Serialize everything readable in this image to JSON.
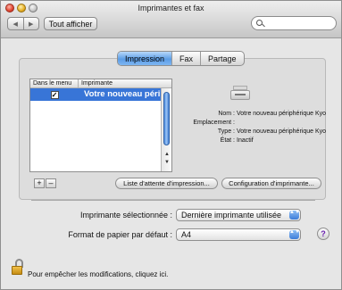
{
  "window": {
    "title": "Imprimantes et fax"
  },
  "toolbar": {
    "back": "◀",
    "forward": "▶",
    "show_all": "Tout afficher",
    "search_placeholder": ""
  },
  "tabs": [
    {
      "label": "Impression",
      "active": true
    },
    {
      "label": "Fax",
      "active": false
    },
    {
      "label": "Partage",
      "active": false
    }
  ],
  "printer_list": {
    "columns": [
      "Dans le menu",
      "Imprimante"
    ],
    "rows": [
      {
        "in_menu": true,
        "check_glyph": "✓",
        "name": "Votre nouveau périp"
      }
    ]
  },
  "scroll": {
    "up": "▲",
    "down": "▼"
  },
  "details": {
    "labels": [
      "Nom :",
      "Emplacement :",
      "Type :",
      "État :"
    ],
    "values": [
      "Votre nouveau périphérique Kyo",
      "",
      "Votre nouveau périphérique Kyo",
      "Inactif"
    ]
  },
  "buttons": {
    "add": "+",
    "remove": "–",
    "print_queue": "Liste d'attente d'impression...",
    "printer_setup": "Configuration d'imprimante..."
  },
  "form": {
    "selected_printer_label": "Imprimante sélectionnée :",
    "selected_printer_value": "Dernière imprimante utilisée",
    "paper_size_label": "Format de papier par défaut :",
    "paper_size_value": "A4",
    "popup_arrows": "▲▼",
    "help": "?"
  },
  "lock": {
    "text": "Pour empêcher les modifications, cliquez ici."
  },
  "colors": {
    "selection": "#3875d7",
    "tab_active": "#5b9de6",
    "panel": "#dddddd"
  }
}
